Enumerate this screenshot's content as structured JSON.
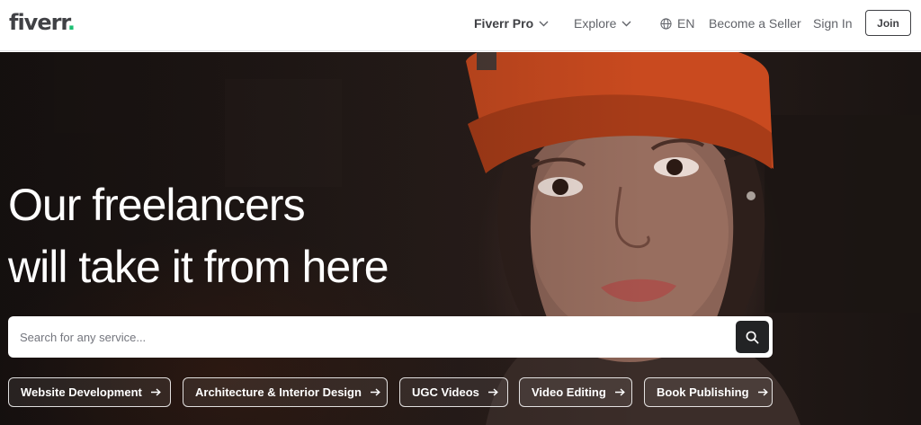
{
  "header": {
    "logo_text": "fiverr",
    "logo_dot": ".",
    "nav": {
      "pro_label": "Fiverr Pro",
      "explore_label": "Explore",
      "language_label": "EN",
      "become_seller_label": "Become a Seller",
      "sign_in_label": "Sign In",
      "join_label": "Join"
    }
  },
  "hero": {
    "headline_line1": "Our freelancers",
    "headline_line2": "will take it from here",
    "search": {
      "placeholder": "Search for any service...",
      "value": ""
    },
    "chips": [
      {
        "label": "Website Development"
      },
      {
        "label": "Architecture & Interior Design"
      },
      {
        "label": "UGC Videos"
      },
      {
        "label": "Video Editing"
      },
      {
        "label": "Book Publishing"
      }
    ]
  },
  "colors": {
    "brand_green": "#1dbf73",
    "text_dark": "#404145",
    "search_button": "#222325"
  },
  "icons": [
    "chevron-down-icon",
    "globe-icon",
    "search-icon",
    "arrow-right-icon"
  ]
}
